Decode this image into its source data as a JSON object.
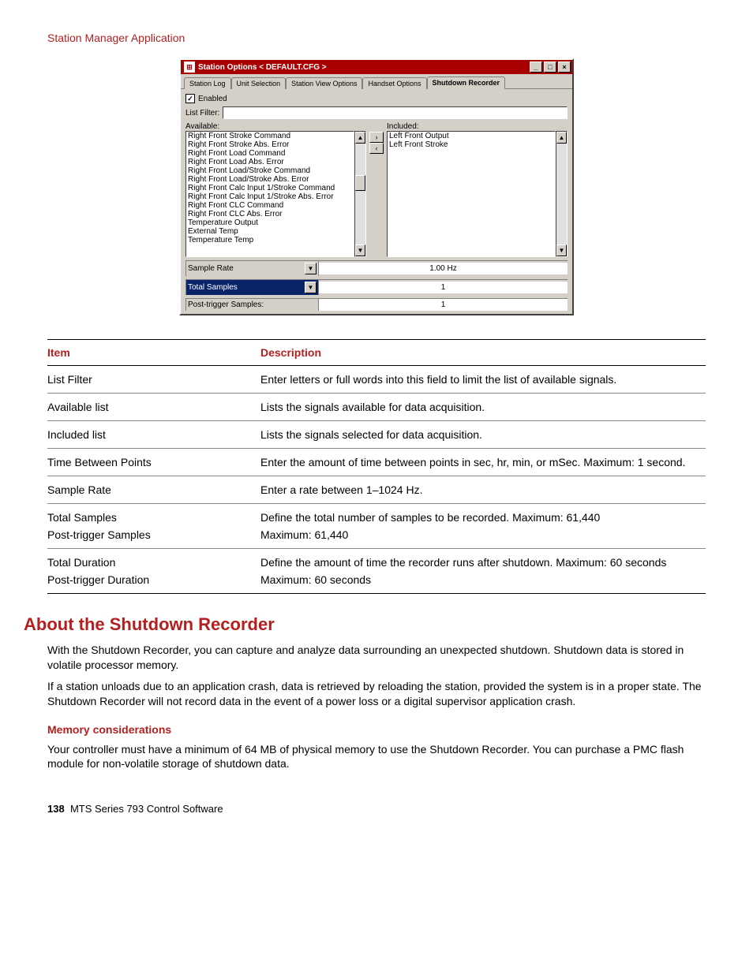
{
  "header": {
    "app_name": "Station Manager Application"
  },
  "window": {
    "title": "Station Options < DEFAULT.CFG >",
    "tabs": [
      {
        "label": "Station Log"
      },
      {
        "label": "Unit Selection"
      },
      {
        "label": "Station View Options"
      },
      {
        "label": "Handset Options"
      },
      {
        "label": "Shutdown Recorder",
        "active": true
      }
    ],
    "enabled_label": "Enabled",
    "list_filter_label": "List Filter:",
    "list_filter_value": "",
    "available_label": "Available:",
    "included_label": "Included:",
    "available_items": [
      "Right Front Stroke Command",
      "Right Front Stroke Abs. Error",
      "Right Front Load Command",
      "Right Front Load Abs. Error",
      "Right Front Load/Stroke Command",
      "Right Front Load/Stroke Abs. Error",
      "Right Front Calc Input 1/Stroke Command",
      "Right Front Calc Input 1/Stroke Abs. Error",
      "Right Front CLC Command",
      "Right Front CLC Abs. Error",
      "Temperature Output",
      "External Temp",
      "Temperature Temp"
    ],
    "included_items": [
      "Left Front Output",
      "Left Front Stroke"
    ],
    "params": {
      "sample_rate": {
        "label": "Sample Rate",
        "value": "1.00  Hz"
      },
      "total_samples": {
        "label": "Total Samples",
        "value": "1"
      },
      "post_trigger": {
        "label": "Post-trigger Samples:",
        "value": "1"
      }
    }
  },
  "doc_table": {
    "headers": {
      "item": "Item",
      "description": "Description"
    },
    "rows": [
      {
        "item": "List Filter",
        "desc": "Enter letters or full words into this field to limit the list of available signals."
      },
      {
        "item": "Available list",
        "desc": "Lists the signals available for data acquisition."
      },
      {
        "item": "Included list",
        "desc": "Lists the signals selected for data acquisition."
      },
      {
        "item": "Time Between Points",
        "desc": "Enter the amount of time between points in sec, hr, min, or mSec. Maximum: 1 second."
      },
      {
        "item": "Sample Rate",
        "desc": "Enter a rate between 1–1024 Hz."
      },
      {
        "item": "Total Samples",
        "desc": "Define the total number of samples to be recorded. Maximum: 61,440"
      },
      {
        "item": "Post-trigger Samples",
        "desc": "Maximum: 61,440"
      },
      {
        "item": "Total Duration",
        "desc": "Define the amount of time the recorder runs after shutdown. Maximum: 60 seconds"
      },
      {
        "item": "Post-trigger Duration",
        "desc": "Maximum: 60 seconds"
      }
    ]
  },
  "section": {
    "heading": "About the Shutdown Recorder",
    "p1": "With the Shutdown Recorder, you can capture and analyze data surrounding an unexpected shutdown. Shutdown data is stored in volatile processor memory.",
    "p2": "If a station unloads due to an application crash, data is retrieved by reloading the station, provided the system is in a proper state. The Shutdown Recorder will not record data in the event of a power loss or a digital supervisor application crash.",
    "sub1_title": "Memory considerations",
    "sub1_body": "Your controller must have a minimum of 64 MB of physical memory to use the Shutdown Recorder. You can purchase a PMC flash module for non-volatile storage of shutdown data."
  },
  "footer": {
    "page_number": "138",
    "product": "MTS Series 793 Control Software"
  },
  "icons": {
    "app": "⊞",
    "minimize": "_",
    "maximize": "□",
    "close": "×",
    "check": "✓",
    "up": "▲",
    "down": "▼",
    "right": "›",
    "left": "‹"
  }
}
